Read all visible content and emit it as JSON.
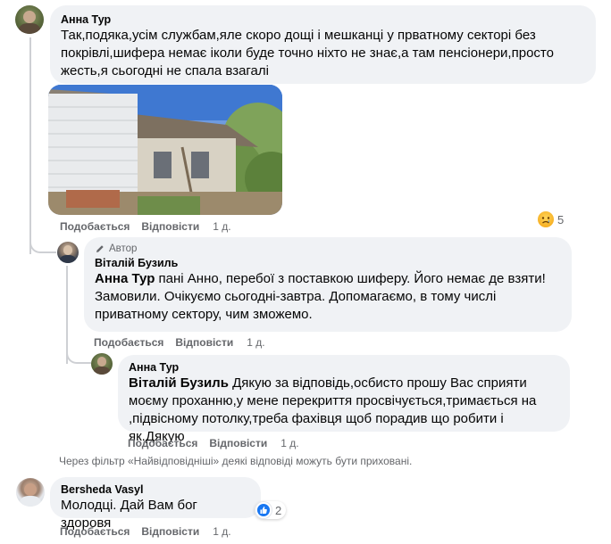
{
  "comments": [
    {
      "author": "Анна Тур",
      "text": "Так,подяка,усім службам,яле скоро дощі і мешканці у прватному секторі без покрівлі,шифера немає іколи буде точно ніхто не знає,а там пенсіонери,просто жесть,я сьогодні не спала взагалі",
      "actions": {
        "like": "Подобається",
        "reply": "Відповісти",
        "time": "1 д."
      },
      "reaction": {
        "icon": "sad-reaction-icon",
        "count": "5"
      }
    },
    {
      "badge": "Автор",
      "author": "Віталій Бузиль",
      "mention": "Анна Тур",
      "text": "пані Анно, перебої з поставкою шиферу. Його немає де взяти! Замовили. Очікуємо сьогодні-завтра. Допомагаємо, в тому числі приватному сектору, чим зможемо.",
      "actions": {
        "like": "Подобається",
        "reply": "Відповісти",
        "time": "1 д."
      }
    },
    {
      "author": "Анна Тур",
      "mention": "Віталій Бузиль",
      "text": "Дякую за відповідь,осбисто прошу Вас сприяти моєму проханню,у мене перекриття просвічується,тримається на ,підвісному потолку,треба фахівця щоб порадив що робити і як.Дякую",
      "actions": {
        "like": "Подобається",
        "reply": "Відповісти",
        "time": "1 д."
      }
    },
    {
      "author": "Bersheda Vasyl",
      "text": "Молодці. Дай Вам бог здоровя",
      "actions": {
        "like": "Подобається",
        "reply": "Відповісти",
        "time": "1 д."
      },
      "reaction": {
        "icon": "like-reaction-icon",
        "count": "2"
      }
    }
  ],
  "filter_note": "Через фільтр «Найвідповідніші» деякі відповіді можуть бути приховані.",
  "colors": {
    "bubble": "#f0f2f5",
    "secondary_text": "#65676b",
    "like_blue": "#1877f2"
  }
}
